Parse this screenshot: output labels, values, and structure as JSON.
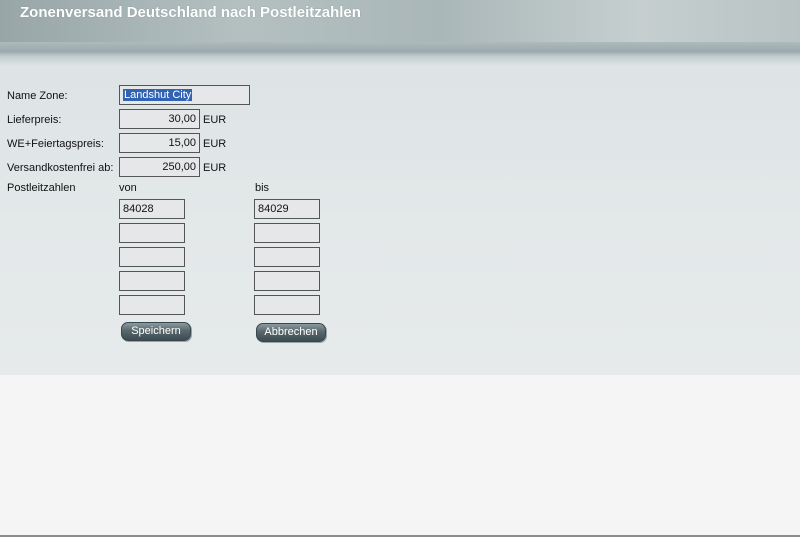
{
  "header": {
    "title": "Zonenversand Deutschland nach Postleitzahlen"
  },
  "form": {
    "name_zone_label": "Name Zone:",
    "name_zone_value": "Landshut City",
    "lieferpreis_label": "Lieferpreis:",
    "lieferpreis_value": "30,00",
    "weekend_label": "WE+Feiertagspreis:",
    "weekend_value": "15,00",
    "free_label": "Versandkostenfrei ab:",
    "free_value": "250,00",
    "currency": "EUR",
    "postcodes_label": "Postleitzahlen",
    "von_label": "von",
    "bis_label": "bis",
    "von_values": [
      "84028",
      "",
      "",
      "",
      ""
    ],
    "bis_values": [
      "84029",
      "",
      "",
      "",
      ""
    ]
  },
  "buttons": {
    "save": "Speichern",
    "cancel": "Abbrechen"
  }
}
